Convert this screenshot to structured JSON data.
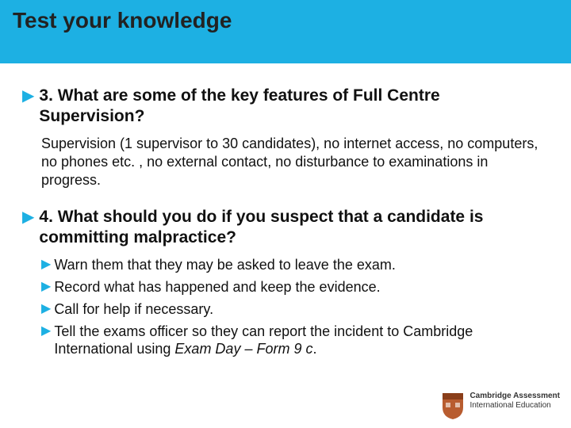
{
  "header": {
    "title": "Test your knowledge"
  },
  "q3": {
    "question": "3. What are some of the key features of Full Centre Supervision?",
    "answer": "Supervision (1 supervisor to 30 candidates), no internet access, no computers, no phones etc. , no external contact, no disturbance to examinations in progress."
  },
  "q4": {
    "question": "4. What should you do if you suspect that a candidate is committing malpractice?",
    "bullets": [
      "Warn them that they may be asked to leave the exam.",
      "Record what has happened and keep the evidence.",
      "Call for help if necessary."
    ],
    "bullet4_prefix": "Tell the exams officer so they can report the incident to Cambridge International using ",
    "bullet4_italic": "Exam Day – Form 9 c",
    "bullet4_suffix": "."
  },
  "logo": {
    "line1": "Cambridge Assessment",
    "line2": "International Education"
  }
}
